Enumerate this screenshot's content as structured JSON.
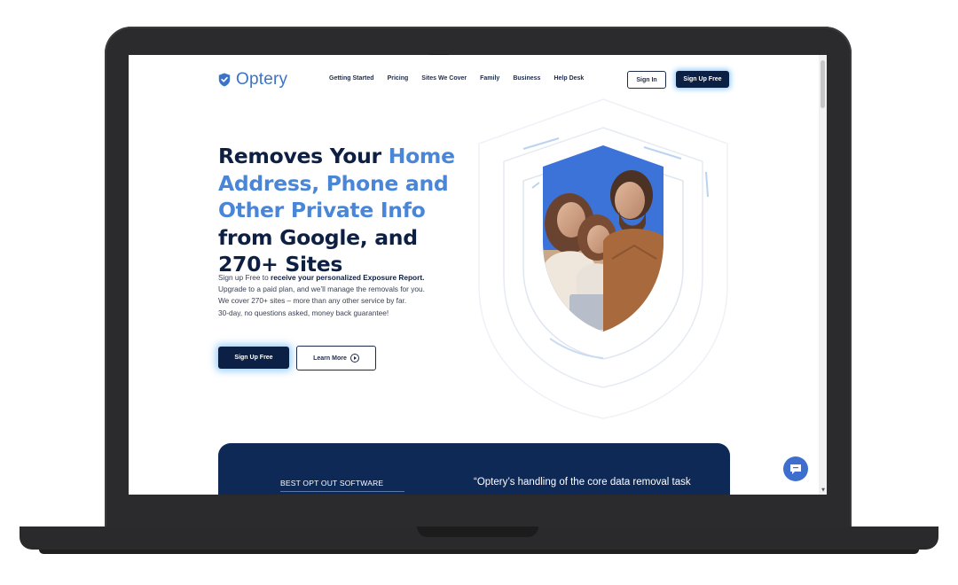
{
  "brand": {
    "name": "Optery",
    "color": "#3b73c9",
    "dark": "#0e1f44",
    "accent": "#4a86d8"
  },
  "nav": {
    "items": [
      "Getting Started",
      "Pricing",
      "Sites We Cover",
      "Family",
      "Business",
      "Help Desk"
    ],
    "signin_label": "Sign In",
    "signup_label": "Sign Up Free"
  },
  "hero": {
    "headline_part1": "Removes Your ",
    "headline_accent": "Home Address, Phone and Other Private Info",
    "headline_part2": " from Google, and 270+ Sites",
    "sub_prefix": "Sign up Free to ",
    "sub_bold": "receive your personalized Exposure Report.",
    "sub_line2": "Upgrade to a paid plan, and we’ll manage the removals for you.",
    "sub_line3": "We cover 270+ sites – more than any other service by far.",
    "sub_line4": "30-day, no questions asked, money back guarantee!",
    "signup_label": "Sign Up Free",
    "learn_label": "Learn More"
  },
  "banner": {
    "left_label": "BEST OPT OUT SOFTWARE",
    "quote": "“Optery’s handling of the core data removal task"
  },
  "icons": {
    "logo": "shield-icon",
    "learn_more": "play-circle-icon",
    "chat": "chat-bubble-icon"
  }
}
